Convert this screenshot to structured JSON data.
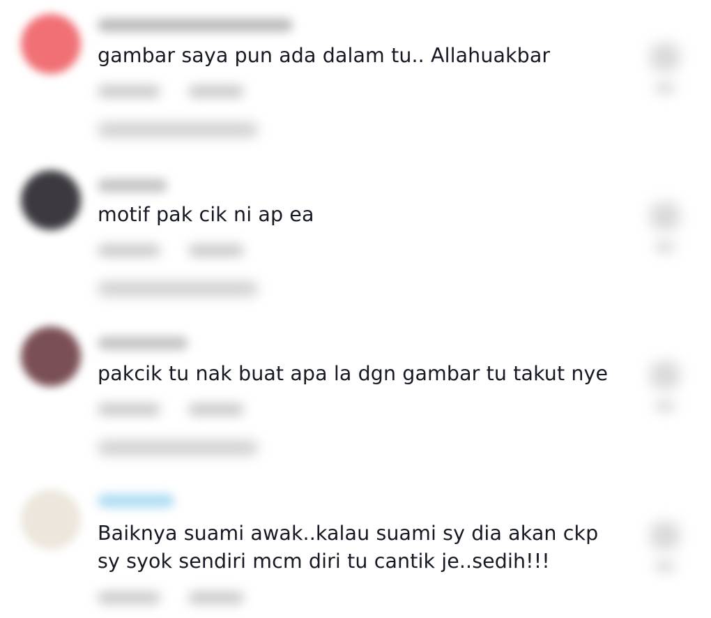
{
  "comments": [
    {
      "text": "gambar saya pun ada dalam tu.. Allahuakbar",
      "avatar_color": "#f07075",
      "username_color": "#9a9a9a"
    },
    {
      "text": "motif pak cik ni ap ea",
      "avatar_color": "#3c3a40",
      "username_color": "#a0a0a0"
    },
    {
      "text": "pakcik tu nak buat apa la dgn gambar tu takut nye",
      "avatar_color": "#7a4f55",
      "username_color": "#a0a0a0"
    },
    {
      "text": "Baiknya suami awak..kalau suami sy dia akan ckp\nsy syok sendiri mcm diri tu cantik je..sedih!!!",
      "avatar_color": "#ece6dc",
      "username_color": "#8fcfee"
    }
  ]
}
